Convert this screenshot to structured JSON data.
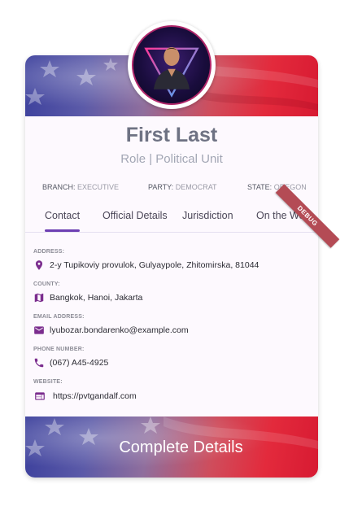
{
  "profile": {
    "name": "First Last",
    "role": "Role | Political Unit"
  },
  "meta": {
    "branch_label": "BRANCH:",
    "branch_value": "EXECUTIVE",
    "party_label": "PARTY:",
    "party_value": "DEMOCRAT",
    "state_label": "STATE:",
    "state_value": "OREGON"
  },
  "tabs": [
    "Contact",
    "Official Details",
    "Jurisdiction",
    "On the Web"
  ],
  "fields": {
    "address": {
      "label": "ADDRESS:",
      "value": "2-y Tupikoviy provulok, Gulyaypole, Zhitomirska, 81044",
      "icon": "location-pin-icon"
    },
    "county": {
      "label": "COUNTY:",
      "value": "Bangkok, Hanoi, Jakarta",
      "icon": "map-icon"
    },
    "email": {
      "label": "EMAIL ADDRESS:",
      "value": "lyubozar.bondarenko@example.com",
      "icon": "mail-icon"
    },
    "phone": {
      "label": "PHONE NUMBER:",
      "value": "(067) A45-4925",
      "icon": "phone-icon"
    },
    "website": {
      "label": "WEBSITE:",
      "value": "https://pvtgandalf.com",
      "icon": "web-icon"
    }
  },
  "debug_banner": "DEBUG",
  "action": {
    "complete_label": "Complete Details"
  },
  "colors": {
    "accent": "#6d3fb3",
    "icon": "#7b2d8e",
    "flag_blue": "#3b3f9c",
    "flag_red": "#e32a3c"
  }
}
